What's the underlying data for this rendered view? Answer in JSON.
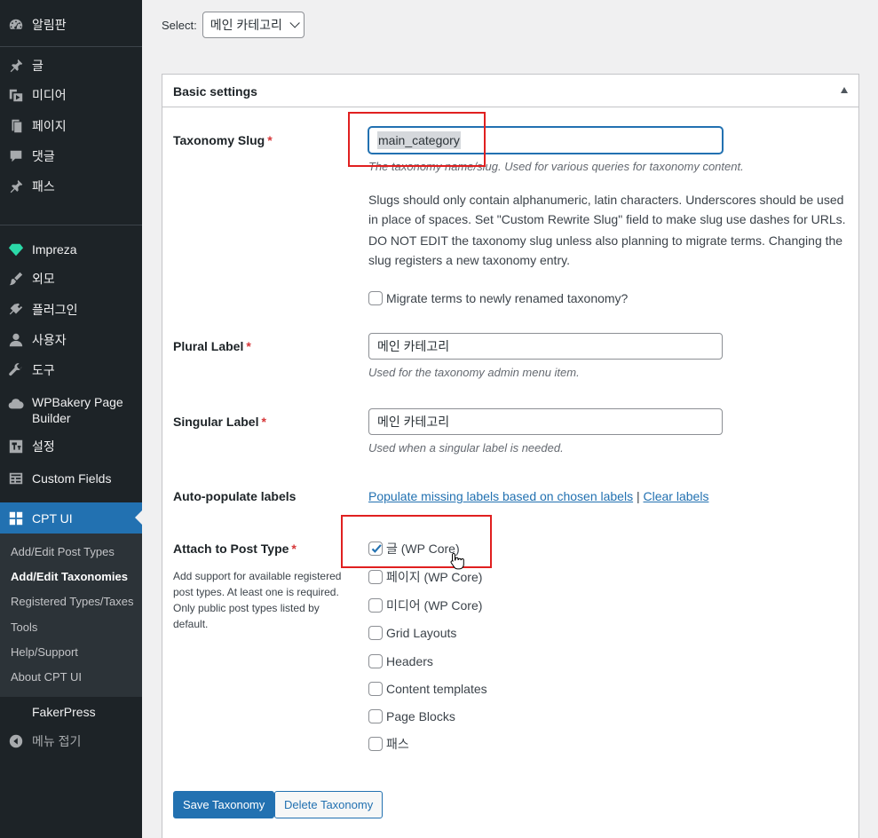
{
  "sidebar": {
    "items": [
      {
        "label": "알림판",
        "icon": "dashboard-icon"
      },
      {
        "label": "글",
        "icon": "pin-icon"
      },
      {
        "label": "미디어",
        "icon": "media-icon"
      },
      {
        "label": "페이지",
        "icon": "page-icon"
      },
      {
        "label": "댓글",
        "icon": "comment-icon"
      },
      {
        "label": "패스",
        "icon": "pin-icon"
      },
      {
        "label": "Impreza",
        "icon": "diamond-icon"
      },
      {
        "label": "외모",
        "icon": "brush-icon"
      },
      {
        "label": "플러그인",
        "icon": "plugin-icon"
      },
      {
        "label": "사용자",
        "icon": "user-icon"
      },
      {
        "label": "도구",
        "icon": "wrench-icon"
      },
      {
        "label": "WPBakery Page Builder",
        "icon": "cloud-icon"
      },
      {
        "label": "설정",
        "icon": "settings-icon"
      },
      {
        "label": "Custom Fields",
        "icon": "table-icon"
      },
      {
        "label": "CPT UI",
        "icon": "grid-icon"
      },
      {
        "label": "FakerPress",
        "icon": ""
      },
      {
        "label": "메뉴 접기",
        "icon": "collapse-icon"
      }
    ],
    "submenu": [
      {
        "label": "Add/Edit Post Types"
      },
      {
        "label": "Add/Edit Taxonomies"
      },
      {
        "label": "Registered Types/Taxes"
      },
      {
        "label": "Tools"
      },
      {
        "label": "Help/Support"
      },
      {
        "label": "About CPT UI"
      }
    ],
    "colors": {
      "bg": "#1d2327",
      "active": "#2271b1",
      "submenu_bg": "#2c3338"
    }
  },
  "select": {
    "label": "Select:",
    "value": "메인 카테고리"
  },
  "panel": {
    "title": "Basic settings"
  },
  "fields": {
    "taxonomy_slug": {
      "label": "Taxonomy Slug",
      "required": "*",
      "value": "main_category",
      "description": "The taxonomy name/slug. Used for various queries for taxonomy content.",
      "note1": "Slugs should only contain alphanumeric, latin characters. Underscores should be used in place of spaces. Set \"Custom Rewrite Slug\" field to make slug use dashes for URLs.",
      "note2": "DO NOT EDIT the taxonomy slug unless also planning to migrate terms. Changing the slug registers a new taxonomy entry.",
      "migrate_label": "Migrate terms to newly renamed taxonomy?"
    },
    "plural_label": {
      "label": "Plural Label",
      "required": "*",
      "value": "메인 카테고리",
      "description": "Used for the taxonomy admin menu item."
    },
    "singular_label": {
      "label": "Singular Label",
      "required": "*",
      "value": "메인 카테고리",
      "description": "Used when a singular label is needed."
    },
    "auto_populate": {
      "label": "Auto-populate labels",
      "link1": "Populate missing labels based on chosen labels",
      "separator": "|",
      "link2": "Clear labels"
    },
    "attach": {
      "label": "Attach to Post Type",
      "required": "*",
      "description": "Add support for available registered post types. At least one is required. Only public post types listed by default.",
      "options": [
        {
          "label": "글 (WP Core)",
          "checked": true
        },
        {
          "label": "페이지 (WP Core)",
          "checked": false
        },
        {
          "label": "미디어 (WP Core)",
          "checked": false
        },
        {
          "label": "Grid Layouts",
          "checked": false
        },
        {
          "label": "Headers",
          "checked": false
        },
        {
          "label": "Content templates",
          "checked": false
        },
        {
          "label": "Page Blocks",
          "checked": false
        },
        {
          "label": "패스",
          "checked": false
        }
      ]
    }
  },
  "buttons": {
    "save": "Save Taxonomy",
    "delete": "Delete Taxonomy"
  },
  "colors": {
    "accent": "#2271b1",
    "required": "#d63638",
    "highlight": "#e02020"
  }
}
